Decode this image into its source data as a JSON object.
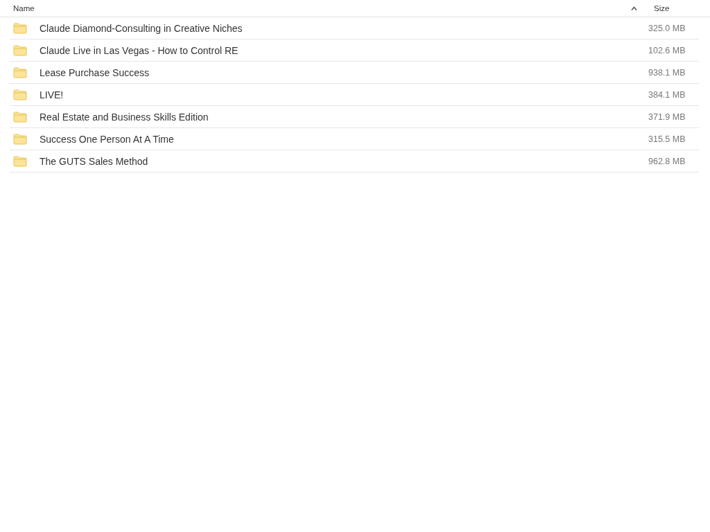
{
  "table": {
    "columns": [
      {
        "label": "Name",
        "sorted": true,
        "ascending": true
      },
      {
        "label": "Size"
      }
    ],
    "rows": [
      {
        "name": "Claude Diamond-Consulting in Creative Niches",
        "size": "325.0 MB"
      },
      {
        "name": "Claude Live in Las Vegas - How to Control RE",
        "size": "102.6 MB"
      },
      {
        "name": "Lease Purchase Success",
        "size": "938.1 MB"
      },
      {
        "name": "LIVE!",
        "size": "384.1 MB"
      },
      {
        "name": "Real Estate and Business Skills Edition",
        "size": "371.9 MB"
      },
      {
        "name": "Success One Person At A Time",
        "size": "315.5 MB"
      },
      {
        "name": "The GUTS Sales Method",
        "size": "962.8 MB"
      }
    ]
  }
}
